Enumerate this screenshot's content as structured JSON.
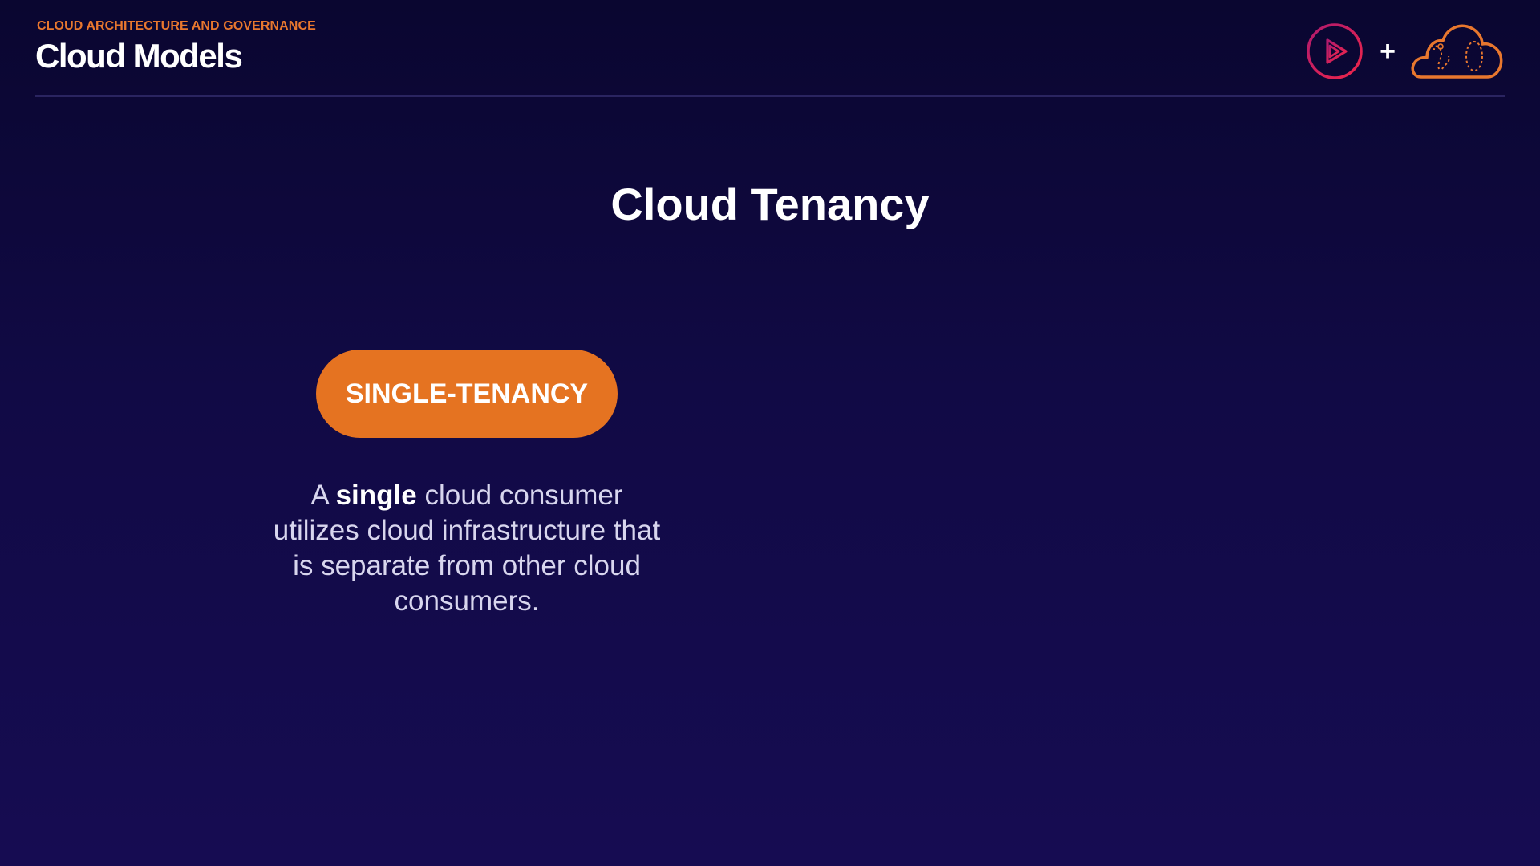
{
  "header": {
    "eyebrow": "CLOUD ARCHITECTURE AND GOVERNANCE",
    "title": "Cloud Models"
  },
  "logos": {
    "plus": "+",
    "icons": [
      "pluralsight-play-logo-icon",
      "cloud-logo-icon"
    ],
    "colors": {
      "pluralsight": "#e8264f",
      "cloud": "#e8772e"
    }
  },
  "slide": {
    "title": "Cloud Tenancy",
    "pill_label": "SINGLE-TENANCY",
    "description": {
      "prefix": "A ",
      "emphasis": "single",
      "suffix": " cloud consumer utilizes cloud infrastructure that is separate from other cloud consumers."
    }
  },
  "colors": {
    "accent": "#e57321",
    "background_top": "#0a0630",
    "background_bottom": "#160c52"
  }
}
